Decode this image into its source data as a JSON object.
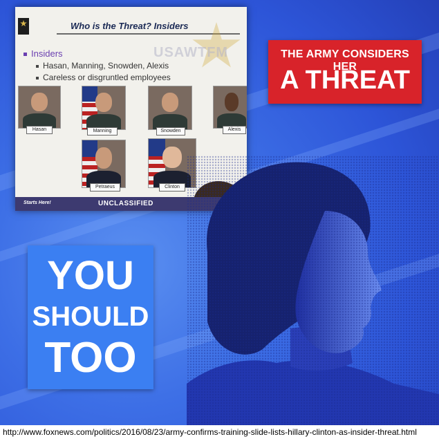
{
  "slide": {
    "title": "Who is the Threat?  Insiders",
    "watermark": "USAWTFM",
    "bullet_main": "Insiders",
    "bullets": [
      "Hasan, Manning, Snowden, Alexis",
      "Careless or disgruntled employees"
    ],
    "people": [
      {
        "name": "Hasan"
      },
      {
        "name": "Manning"
      },
      {
        "name": "Snowden"
      },
      {
        "name": "Alexis"
      },
      {
        "name": "Petraeus"
      },
      {
        "name": "Clinton"
      }
    ],
    "footer_left": "Starts Here!",
    "footer_center": "UNCLASSIFIED"
  },
  "callout_red": {
    "line1": "THE ARMY CONSIDERS HER",
    "line2": "A THREAT"
  },
  "callout_blue": {
    "line1": "YOU",
    "line2": "SHOULD",
    "line3": "TOO"
  },
  "source_url": "http://www.foxnews.com/politics/2016/08/23/army-confirms-training-slide-lists-hillary-clinton-as-insider-threat.html",
  "colors": {
    "background": "#3d6fe6",
    "red_callout": "#d8232a",
    "blue_callout": "#3b7ff2"
  }
}
